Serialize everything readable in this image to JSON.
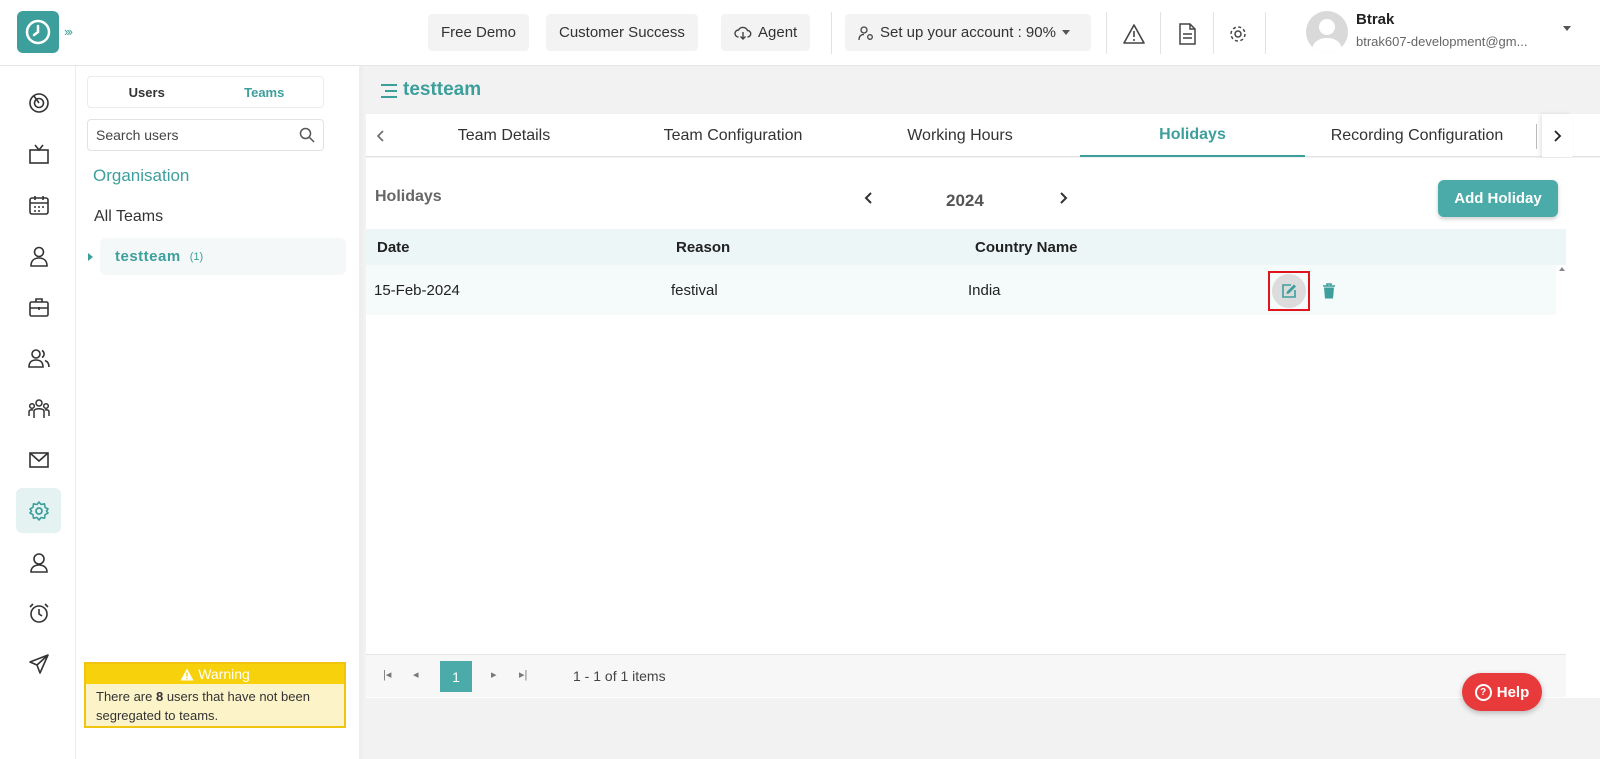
{
  "colors": {
    "accent": "#3d9f9c",
    "warning": "#f7d10b",
    "help": "#e8393b",
    "highlight": "#e0141c"
  },
  "topbar": {
    "expand_icon": "double-chevron-right-icon",
    "free_demo": "Free Demo",
    "customer_success": "Customer Success",
    "agent": "Agent",
    "setup": "Set up your account : 90%",
    "user_name": "Btrak",
    "user_email": "btrak607-development@gm..."
  },
  "rail": {
    "icons": [
      "dashboard-icon",
      "tv-icon",
      "calendar-icon",
      "user-icon",
      "briefcase-icon",
      "users-icon",
      "team-icon",
      "mail-icon",
      "settings-icon",
      "profile-icon",
      "alarm-icon",
      "send-icon"
    ],
    "active": "settings-icon"
  },
  "team_panel": {
    "tab_users": "Users",
    "tab_teams": "Teams",
    "search_placeholder": "Search users",
    "organisation": "Organisation",
    "all_teams": "All Teams",
    "team_name": "testteam",
    "team_count": "(1)",
    "warning_title": "Warning",
    "warning_pre": "There are ",
    "warning_count": "8",
    "warning_post": " users that have not been segregated to teams."
  },
  "main": {
    "team_title": "testteam",
    "tabs": [
      "Team Details",
      "Team Configuration",
      "Working Hours",
      "Holidays",
      "Recording Configuration"
    ],
    "active_tab": "Holidays",
    "section_title": "Holidays",
    "year": "2024",
    "add_button": "Add Holiday",
    "columns": [
      "Date",
      "Reason",
      "Country Name"
    ],
    "rows": [
      {
        "date": "15-Feb-2024",
        "reason": "festival",
        "country": "India"
      }
    ],
    "page": "1",
    "page_info": "1 - 1 of 1 items",
    "help": "Help"
  }
}
